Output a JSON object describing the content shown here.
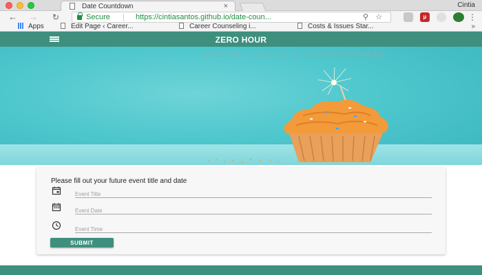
{
  "browser": {
    "tab_title": "Date Countdown",
    "tab_close": "×",
    "profile_name": "Cintia",
    "secure_label": "Secure",
    "url": "https://cintiasantos.github.io/date-coun...",
    "bookmarks": [
      "Apps",
      "Edit Page ‹ Career...",
      "Career Counseling i...",
      "Costs & Issues Star..."
    ],
    "bookmarks_more": "»",
    "ext_label": "μ",
    "icons": [
      "back-icon",
      "forward-icon",
      "reload-icon",
      "lock-icon",
      "zoom-icon",
      "star-icon",
      "menu-icon"
    ]
  },
  "navbar": {
    "brand": "ZERO HOUR"
  },
  "hero": {
    "tagline": "Never, ever underestimate the importance of having fun."
  },
  "form": {
    "title": "Please fill out your future event title and date",
    "title_placeholder": "Event Title",
    "date_placeholder": "Event Date",
    "time_placeholder": "Event Time",
    "submit_label": "SUBMIT"
  },
  "colors": {
    "accent": "#3f8f7e",
    "hero": "#4ec7cd",
    "secure": "#1e8e3e"
  }
}
